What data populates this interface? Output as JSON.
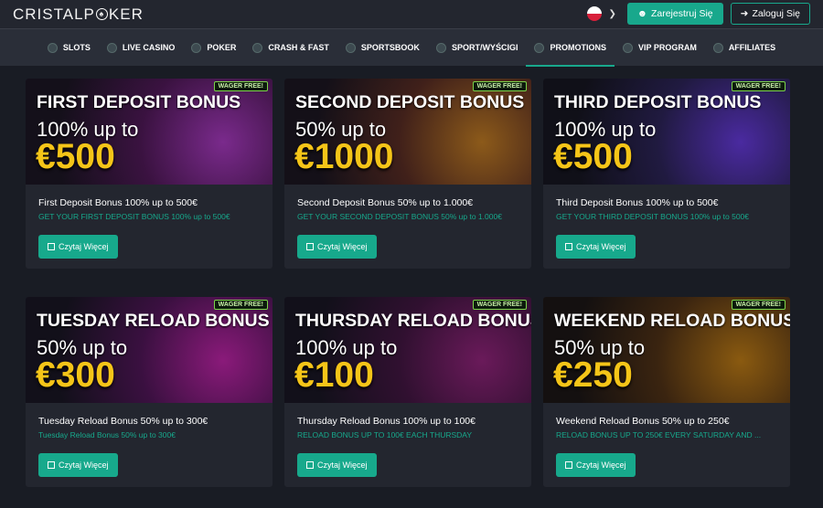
{
  "header": {
    "logo_text_left": "CRISTAL",
    "logo_text_right": "KER",
    "logo_mark": "O",
    "language_flag": "poland-flag-icon",
    "register_label": "Zarejestruj Się",
    "login_label": "Zaloguj Się"
  },
  "nav": {
    "items": [
      {
        "label": "SLOTS",
        "icon": "slots-icon"
      },
      {
        "label": "LIVE CASINO",
        "icon": "live-casino-icon"
      },
      {
        "label": "POKER",
        "icon": "poker-icon"
      },
      {
        "label": "CRASH & FAST",
        "icon": "crash-icon"
      },
      {
        "label": "SPORTSBOOK",
        "icon": "sportsbook-icon"
      },
      {
        "label": "SPORT/WYŚCIGI",
        "icon": "sport-icon"
      },
      {
        "label": "PROMOTIONS",
        "icon": "promotions-icon",
        "active": true
      },
      {
        "label": "VIP PROGRAM",
        "icon": "vip-icon"
      },
      {
        "label": "AFFILIATES",
        "icon": "affiliates-icon"
      }
    ]
  },
  "promos": [
    {
      "badge": "WAGER FREE!",
      "banner_title": "FIRST DEPOSIT BONUS",
      "banner_sub": "100% up to",
      "banner_amount": "€500",
      "title": "First Deposit Bonus 100% up to 500€",
      "desc": "GET YOUR FIRST DEPOSIT BONUS 100% up to 500€",
      "button": "Czytaj Więcej",
      "accent": "#7a2a8c"
    },
    {
      "badge": "WAGER FREE!",
      "banner_title": "SECOND DEPOSIT BONUS",
      "banner_sub": "50% up to",
      "banner_amount": "€1000",
      "title": "Second Deposit Bonus 50% up to 1.000€",
      "desc": "GET YOUR SECOND DEPOSIT BONUS 50% up to 1.000€",
      "button": "Czytaj Więcej",
      "accent": "#8c5a1a"
    },
    {
      "badge": "WAGER FREE!",
      "banner_title": "THIRD DEPOSIT BONUS",
      "banner_sub": "100% up to",
      "banner_amount": "€500",
      "title": "Third Deposit Bonus 100% up to 500€",
      "desc": "GET YOUR THIRD DEPOSIT BONUS 100% up to 500€",
      "button": "Czytaj Więcej",
      "accent": "#4a2aa0"
    },
    {
      "badge": "WAGER FREE!",
      "banner_title": "TUESDAY RELOAD BONUS",
      "banner_sub": "50% up to",
      "banner_amount": "€300",
      "title": "Tuesday Reload Bonus 50% up to 300€",
      "desc": "Tuesday Reload Bonus 50% up to 300€",
      "button": "Czytaj Więcej",
      "accent": "#8a1a7a"
    },
    {
      "badge": "WAGER FREE!",
      "banner_title": "THURSDAY RELOAD BONUS",
      "banner_sub": "100% up to",
      "banner_amount": "€100",
      "title": "Thursday Reload Bonus 100% up to 100€",
      "desc": "RELOAD BONUS UP TO 100€ EACH THURSDAY",
      "button": "Czytaj Więcej",
      "accent": "#6a1a5a"
    },
    {
      "badge": "WAGER FREE!",
      "banner_title": "WEEKEND RELOAD BONUS",
      "banner_sub": "50% up to",
      "banner_amount": "€250",
      "title": "Weekend Reload Bonus 50% up to 250€",
      "desc": "RELOAD BONUS UP TO 250€ EVERY SATURDAY AND ...",
      "button": "Czytaj Więcej",
      "accent": "#8a5a10"
    }
  ]
}
